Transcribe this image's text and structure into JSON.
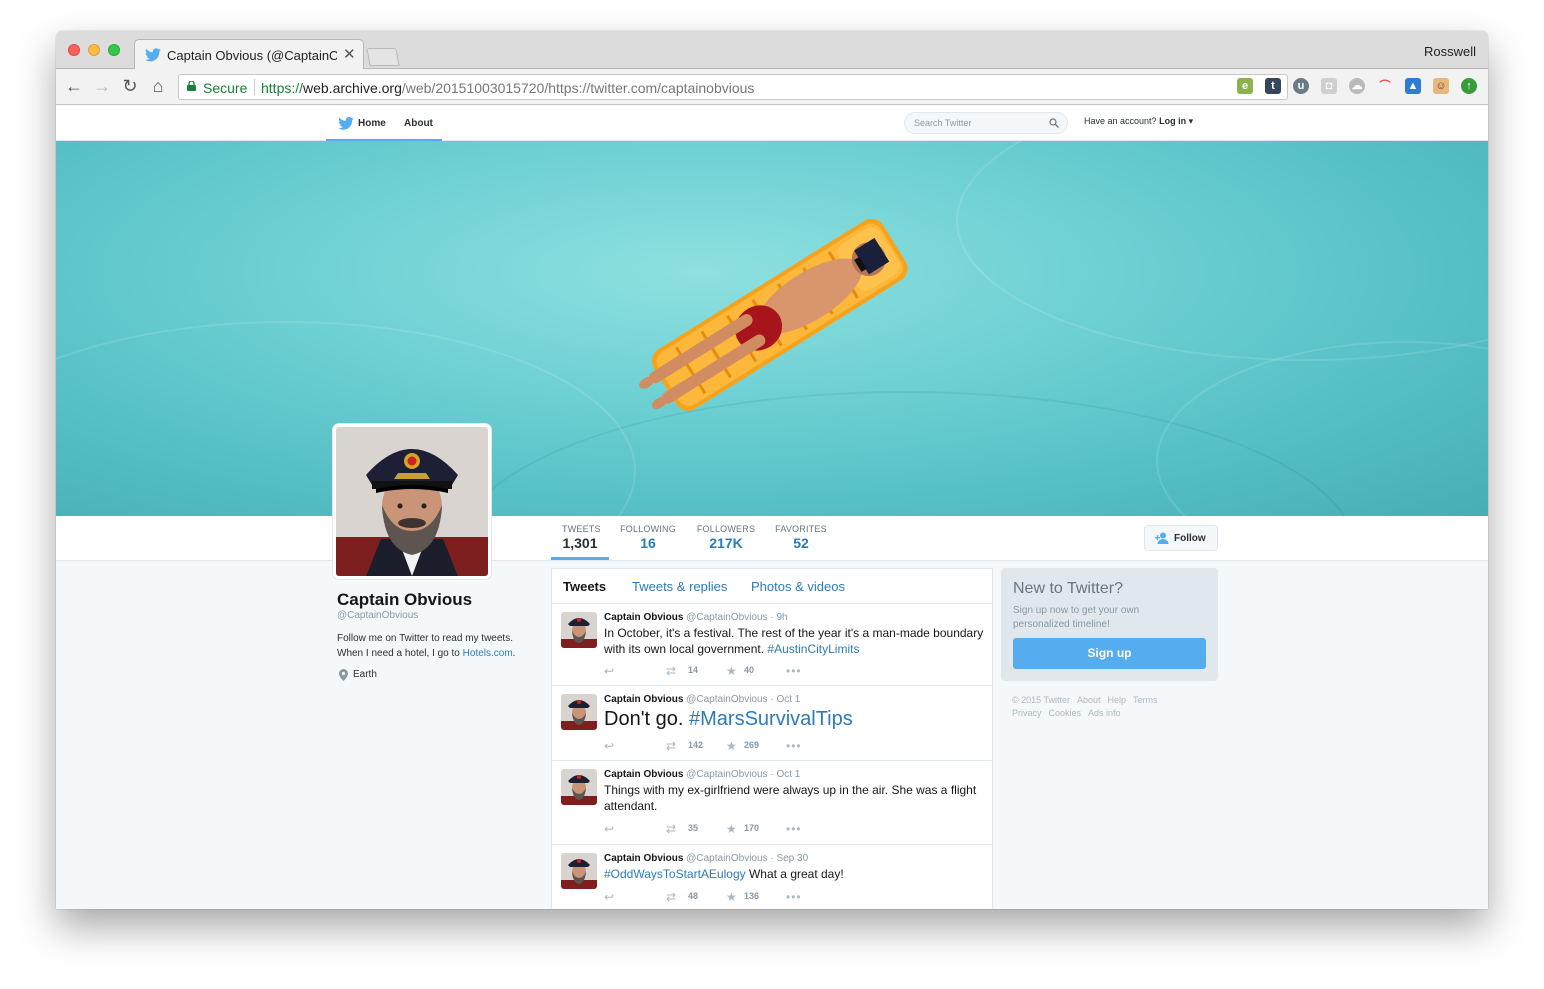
{
  "browser": {
    "tab_title": "Captain Obvious (@CaptainOb",
    "profile_name": "Rosswell",
    "secure_label": "Secure",
    "url_scheme": "https://",
    "url_host": "web.archive.org",
    "url_rest": "/web/20151003015720/https://twitter.com/captainobvious"
  },
  "topbar": {
    "home_label": "Home",
    "about_label": "About",
    "search_placeholder": "Search Twitter",
    "have_account": "Have an account?",
    "login_label": "Log in"
  },
  "stats": [
    {
      "label": "TWEETS",
      "value": "1,301"
    },
    {
      "label": "FOLLOWING",
      "value": "16"
    },
    {
      "label": "FOLLOWERS",
      "value": "217K"
    },
    {
      "label": "FAVORITES",
      "value": "52"
    }
  ],
  "follow_label": "Follow",
  "profile": {
    "name": "Captain Obvious",
    "handle": "@CaptainObvious",
    "bio_1": "Follow me on Twitter to read my tweets.",
    "bio_2": "When I need a hotel, I go to",
    "bio_link": "Hotels.com",
    "bio_end": ".",
    "location": "Earth"
  },
  "stream_tabs": [
    "Tweets",
    "Tweets & replies",
    "Photos & videos"
  ],
  "tweets": [
    {
      "name": "Captain Obvious",
      "handle": "@CaptainObvious",
      "time": "9h",
      "text": "In October, it's a festival. The rest of the year it's a man-made boundary with its own local government.",
      "tag": "#AustinCityLimits",
      "retweets": "14",
      "favorites": "40"
    },
    {
      "name": "Captain Obvious",
      "handle": "@CaptainObvious",
      "time": "Oct 1",
      "text": "Don't go.",
      "tag": "#MarsSurvivalTips",
      "retweets": "142",
      "favorites": "269"
    },
    {
      "name": "Captain Obvious",
      "handle": "@CaptainObvious",
      "time": "Oct 1",
      "text": "Things with my ex-girlfriend were always up in the air. She was a flight attendant.",
      "tag": "",
      "retweets": "35",
      "favorites": "170"
    },
    {
      "name": "Captain Obvious",
      "handle": "@CaptainObvious",
      "time": "Sep 30",
      "tag": "#OddWaysToStartAEulogy",
      "text": "What a great day!",
      "retweets": "48",
      "favorites": "136"
    }
  ],
  "signup": {
    "title": "New to Twitter?",
    "subtitle": "Sign up now to get your own personalized timeline!",
    "button": "Sign up"
  },
  "footer": [
    "© 2015 Twitter",
    "About",
    "Help",
    "Terms",
    "Privacy",
    "Cookies",
    "Ads info"
  ],
  "colors": {
    "accent": "#55acee",
    "link": "#2b7bb9",
    "pool": "#6fd1d4"
  }
}
